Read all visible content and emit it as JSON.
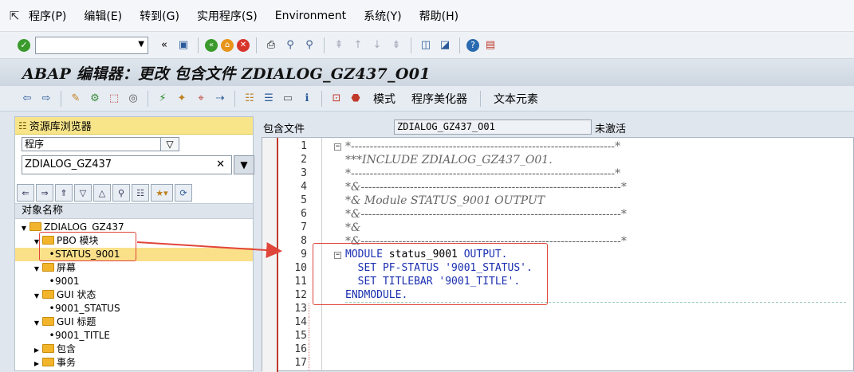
{
  "menubar": {
    "items": [
      "程序(P)",
      "编辑(E)",
      "转到(G)",
      "实用程序(S)",
      "Environment",
      "系统(Y)",
      "帮助(H)"
    ]
  },
  "title": "ABAP 编辑器：更改 包含文件 ZDIALOG_GZ437_O01",
  "app_toolbar": {
    "mode": "模式",
    "pretty_printer": "程序美化器",
    "text_elements": "文本元素"
  },
  "navigator": {
    "header": "资源库浏览器",
    "object_type": "程序",
    "object_name": "ZDIALOG_GZ437",
    "column_header": "对象名称",
    "tree": [
      {
        "label": "ZDIALOG_GZ437",
        "level": 0,
        "type": "folder",
        "open": true
      },
      {
        "label": "PBO 模块",
        "level": 1,
        "type": "folder",
        "open": true
      },
      {
        "label": "STATUS_9001",
        "level": 2,
        "type": "leaf",
        "selected": true
      },
      {
        "label": "屏幕",
        "level": 1,
        "type": "folder",
        "open": true
      },
      {
        "label": "9001",
        "level": 2,
        "type": "leaf"
      },
      {
        "label": "GUI 状态",
        "level": 1,
        "type": "folder",
        "open": true
      },
      {
        "label": "9001_STATUS",
        "level": 2,
        "type": "leaf"
      },
      {
        "label": "GUI 标题",
        "level": 1,
        "type": "folder",
        "open": true
      },
      {
        "label": "9001_TITLE",
        "level": 2,
        "type": "leaf"
      },
      {
        "label": "包含",
        "level": 1,
        "type": "folder",
        "open": false
      },
      {
        "label": "事务",
        "level": 1,
        "type": "folder",
        "open": false
      }
    ]
  },
  "include": {
    "label": "包含文件",
    "name": "ZDIALOG_GZ437_O01",
    "status": "未激活"
  },
  "editor": {
    "lines": [
      {
        "n": "1",
        "text": "*----------------------------------------------------------------------*",
        "kind": "cmt"
      },
      {
        "n": "2",
        "text": "***INCLUDE ZDIALOG_GZ437_O01.",
        "kind": "cmt"
      },
      {
        "n": "3",
        "text": "*----------------------------------------------------------------------*",
        "kind": "cmt"
      },
      {
        "n": "4",
        "text": "*&---------------------------------------------------------------------*",
        "kind": "cmt"
      },
      {
        "n": "5",
        "text": "*& Module STATUS_9001 OUTPUT",
        "kind": "cmt"
      },
      {
        "n": "6",
        "text": "*&---------------------------------------------------------------------*",
        "kind": "cmt"
      },
      {
        "n": "7",
        "text": "*&",
        "kind": "cmt"
      },
      {
        "n": "8",
        "text": "*&---------------------------------------------------------------------*",
        "kind": "cmt"
      },
      {
        "n": "9",
        "kw1": "MODULE",
        "plain": " status_9001 ",
        "kw2": "OUTPUT.",
        "kind": "code"
      },
      {
        "n": "10",
        "kw1": "  SET PF-STATUS ",
        "str": "'9001_STATUS'",
        "kw2": ".",
        "kind": "code"
      },
      {
        "n": "11",
        "kw1": "  SET TITLEBAR ",
        "str": "'9001_TITLE'",
        "kw2": ".",
        "kind": "code"
      },
      {
        "n": "12",
        "kw1": "ENDMODULE.",
        "kind": "code"
      },
      {
        "n": "13"
      },
      {
        "n": "14"
      },
      {
        "n": "15"
      },
      {
        "n": "16"
      },
      {
        "n": "17"
      }
    ]
  }
}
